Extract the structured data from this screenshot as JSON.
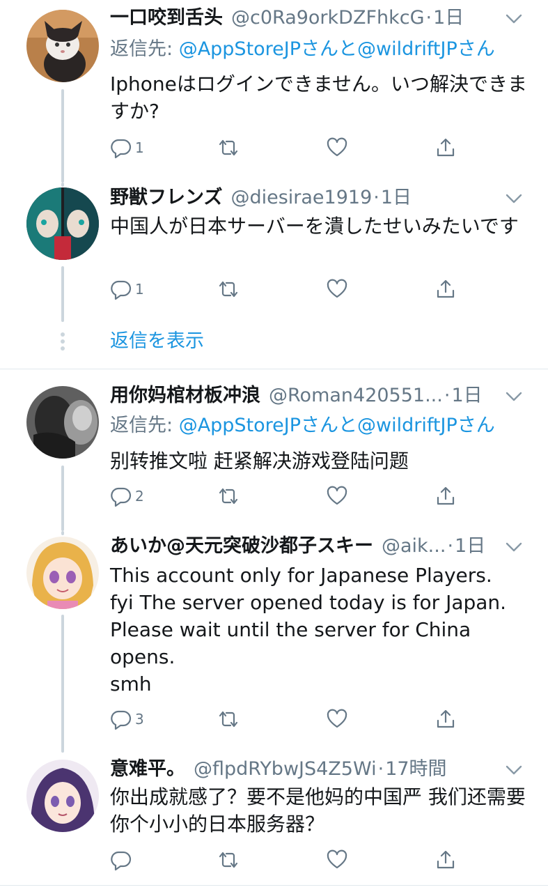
{
  "colors": {
    "link": "#1b95e0",
    "secondary": "#657786",
    "text": "#14171a",
    "line": "#ccd6dd"
  },
  "tweets": [
    {
      "name": "一口咬到舌头",
      "handle": "@c0Ra9orkDZFhkcG",
      "time": "1日",
      "reply_prefix": "返信先: ",
      "reply_to": "@AppStoreJPさんと@wildriftJPさん",
      "text": "Iphoneはログインできません。いつ解決できますか?",
      "reply_count": "1",
      "avatar_icon": "cat-avatar"
    },
    {
      "name": "野獣フレンズ",
      "handle": "@diesirae1919",
      "time": "1日",
      "text": "中国人が日本サーバーを潰したせいみたいです",
      "reply_count": "1",
      "avatar_icon": "anime-twins-avatar"
    },
    {
      "name": "用你妈棺材板冲浪",
      "handle": "@Roman420551...",
      "time": "1日",
      "reply_prefix": "返信先: ",
      "reply_to": "@AppStoreJPさんと@wildriftJPさん",
      "text": "别转推文啦  赶紧解决游戏登陆问题",
      "reply_count": "2",
      "avatar_icon": "monochrome-photo-avatar"
    },
    {
      "name": "あいか@天元突破沙都子スキー",
      "handle": "@aik...",
      "time": "1日",
      "text": "This account only for Japanese Players.\nfyi The server opened today is for Japan.\nPlease wait until the server for China opens.\nsmh",
      "reply_count": "3",
      "avatar_icon": "anime-girl-blonde-avatar"
    },
    {
      "name": "意难平。",
      "handle": "@flpdRYbwJS4Z5Wi",
      "time": "17時間",
      "text": "你出成就感了？要不是他妈的中国严 我们还需要你个小小的日本服务器？",
      "reply_count": "",
      "avatar_icon": "anime-girl-purple-avatar"
    }
  ],
  "show_replies_label": "返信を表示",
  "dot_separator": "·"
}
